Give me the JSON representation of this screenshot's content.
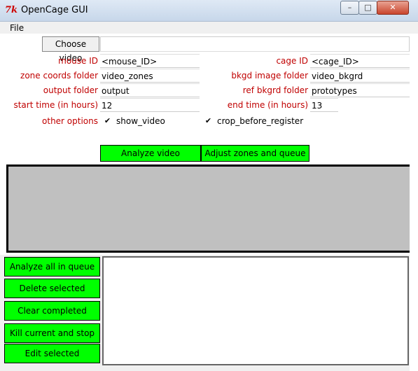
{
  "window": {
    "title": "OpenCage GUI",
    "icon": "tk-icon",
    "minimize": "–",
    "maximize": "□",
    "close": "✕"
  },
  "menu": {
    "file": "File"
  },
  "video": {
    "choose_label": "Choose video",
    "path": ""
  },
  "fields": {
    "mouse_id": {
      "label": "mouse ID",
      "value": "<mouse_ID>"
    },
    "cage_id": {
      "label": "cage ID",
      "value": "<cage_ID>"
    },
    "zone_coords": {
      "label": "zone coords folder",
      "value": "video_zones"
    },
    "bkgd_image": {
      "label": "bkgd image folder",
      "value": "video_bkgrd"
    },
    "output": {
      "label": "output folder",
      "value": "output"
    },
    "ref_bkgrd": {
      "label": "ref bkgrd folder",
      "value": "prototypes"
    },
    "start_time": {
      "label": "start time (in hours)",
      "value": "12"
    },
    "end_time": {
      "label": "end time (in hours)",
      "value": "13"
    }
  },
  "options": {
    "label": "other options",
    "show_video": {
      "label": "show_video",
      "checked": "✔"
    },
    "crop": {
      "label": "crop_before_register",
      "checked": "✔"
    }
  },
  "actions": {
    "analyze_video": "Analyze video",
    "adjust_zones": "Adjust zones and queue"
  },
  "queue": {
    "analyze_all": "Analyze all in queue",
    "delete_selected": "Delete selected",
    "clear_completed": "Clear completed",
    "kill_stop": "Kill current and stop",
    "edit_selected": "Edit selected"
  },
  "colors": {
    "accent": "#00ff00",
    "label": "#c00000",
    "canvas": "#c0c0c0"
  }
}
